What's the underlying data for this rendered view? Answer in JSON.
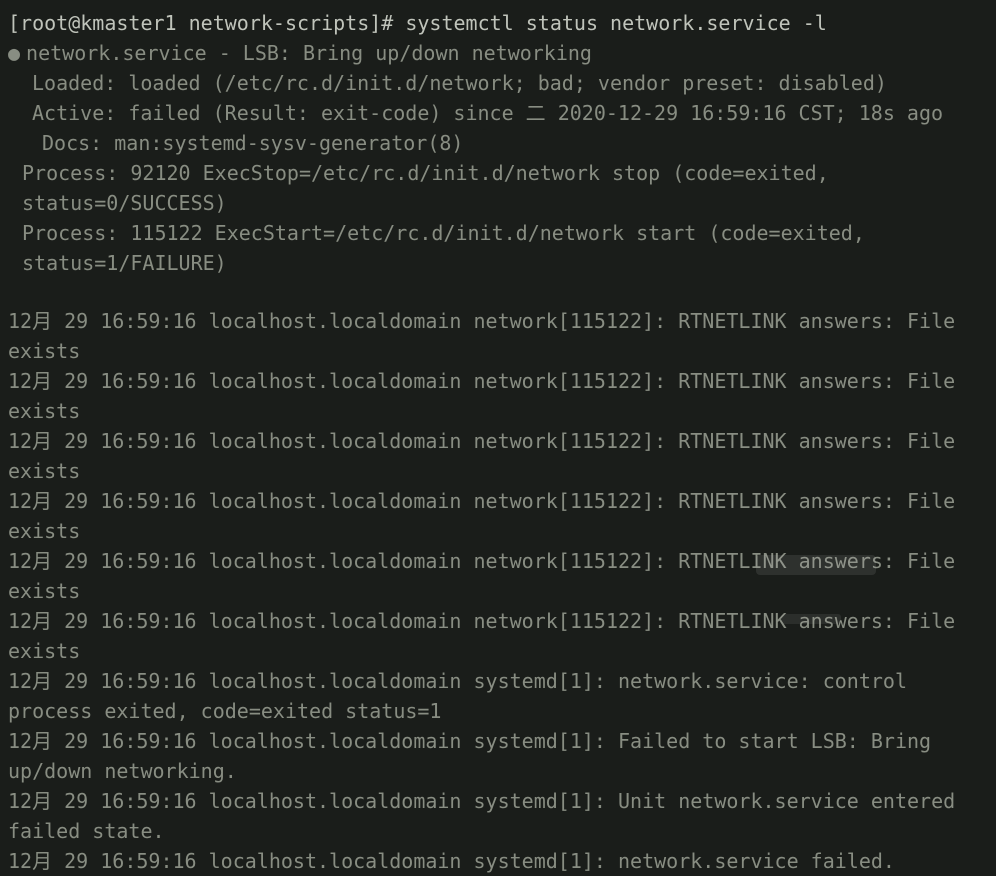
{
  "terminal": {
    "prompt": "[root@kmaster1 network-scripts]# systemctl status network.service -l",
    "service_header": "network.service - LSB: Bring up/down networking",
    "loaded": "Loaded: loaded (/etc/rc.d/init.d/network; bad; vendor preset: disabled)",
    "active": "Active: failed (Result: exit-code) since 二 2020-12-29 16:59:16 CST; 18s ago",
    "docs": "Docs: man:systemd-sysv-generator(8)",
    "process_stop": "Process: 92120 ExecStop=/etc/rc.d/init.d/network stop (code=exited, status=0/SUCCESS)",
    "process_start": "Process: 115122 ExecStart=/etc/rc.d/init.d/network start (code=exited, status=1/FAILURE)",
    "log_entries": [
      "12月 29 16:59:16 localhost.localdomain network[115122]: RTNETLINK answers: File exists",
      "12月 29 16:59:16 localhost.localdomain network[115122]: RTNETLINK answers: File exists",
      "12月 29 16:59:16 localhost.localdomain network[115122]: RTNETLINK answers: File exists",
      "12月 29 16:59:16 localhost.localdomain network[115122]: RTNETLINK answers: File exists",
      "12月 29 16:59:16 localhost.localdomain network[115122]: RTNETLINK answers: File exists",
      "12月 29 16:59:16 localhost.localdomain network[115122]: RTNETLINK answers: File exists",
      "12月 29 16:59:16 localhost.localdomain systemd[1]: network.service: control process exited, code=exited status=1",
      "12月 29 16:59:16 localhost.localdomain systemd[1]: Failed to start LSB: Bring up/down networking.",
      "12月 29 16:59:16 localhost.localdomain systemd[1]: Unit network.service entered failed state.",
      "12月 29 16:59:16 localhost.localdomain systemd[1]: network.service failed."
    ]
  }
}
